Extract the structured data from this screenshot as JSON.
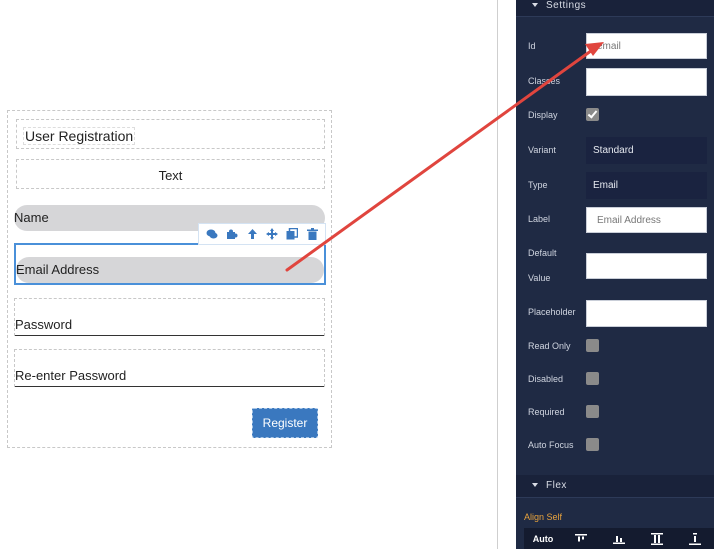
{
  "form": {
    "title": "User Registration",
    "text_block": "Text",
    "fields": {
      "name_label": "Name",
      "email_label": "Email Address",
      "password_label": "Password",
      "reenter_label": "Re-enter Password"
    },
    "register_label": "Register",
    "toolbar_icons": [
      "comment-icon",
      "puzzle-icon",
      "arrow-up-icon",
      "move-icon",
      "copy-icon",
      "trash-icon"
    ]
  },
  "settings": {
    "section_title": "Settings",
    "id_label": "Id",
    "id_value": "email",
    "classes_label": "Classes",
    "classes_value": "",
    "display_label": "Display",
    "display_checked": true,
    "variant_label": "Variant",
    "variant_value": "Standard",
    "type_label": "Type",
    "type_value": "Email",
    "label_label": "Label",
    "label_value": "Email Address",
    "default_label_1": "Default",
    "default_label_2": "Value",
    "default_value": "",
    "placeholder_label": "Placeholder",
    "placeholder_value": "",
    "readonly_label": "Read Only",
    "disabled_label": "Disabled",
    "required_label": "Required",
    "autofocus_label": "Auto Focus"
  },
  "flex": {
    "section_title": "Flex",
    "align_self_label": "Align Self",
    "align_options": [
      "Auto",
      "flex-start-icon",
      "flex-end-icon",
      "stretch-icon",
      "baseline-icon"
    ]
  },
  "colors": {
    "panel_bg": "#1f2a44",
    "accent_blue": "#3a78bf",
    "annotation_arrow": "#e0453e",
    "align_label": "#e8a33d"
  }
}
